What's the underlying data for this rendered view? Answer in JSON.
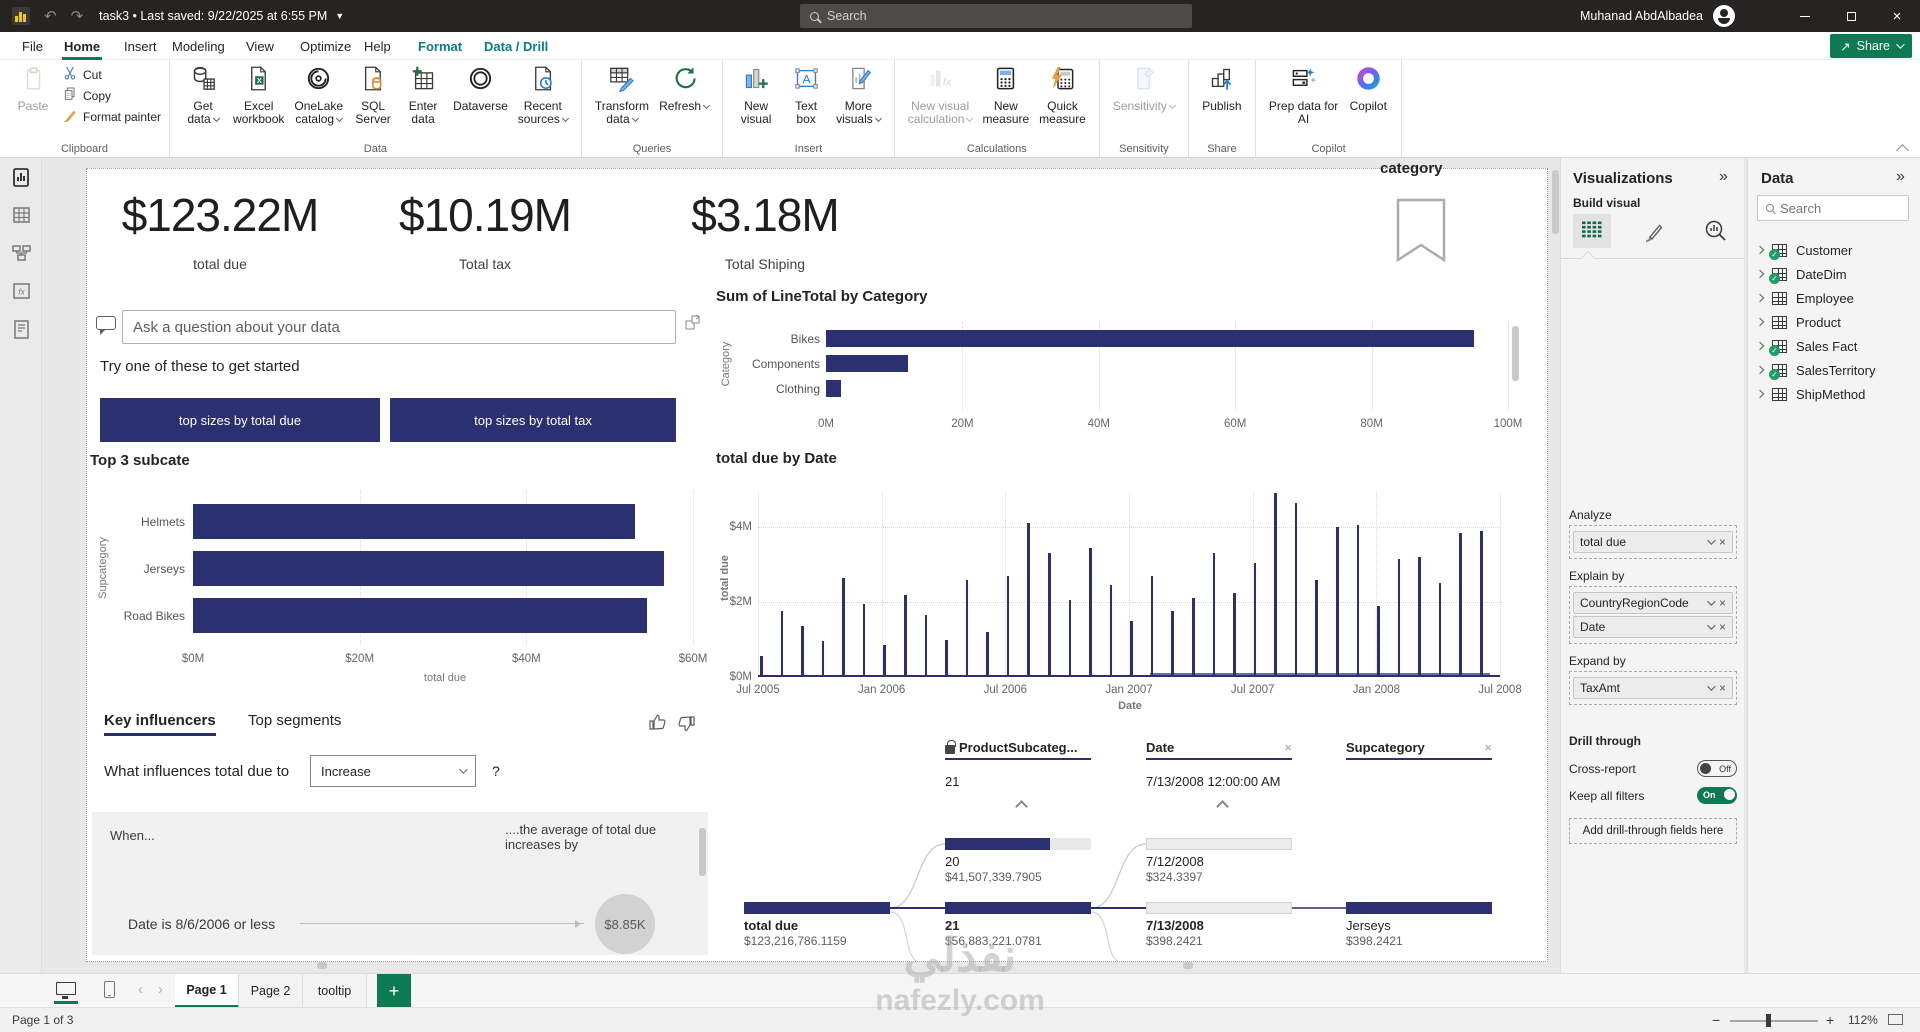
{
  "titlebar": {
    "title": "task3 • Last saved: 9/22/2025 at 6:55 PM",
    "search_placeholder": "Search",
    "user": "Muhanad AbdAlbadea"
  },
  "ribbon": {
    "tabs": [
      {
        "label": "File"
      },
      {
        "label": "Home",
        "active": true
      },
      {
        "label": "Insert"
      },
      {
        "label": "Modeling"
      },
      {
        "label": "View"
      },
      {
        "label": "Optimize"
      },
      {
        "label": "Help"
      },
      {
        "label": "Format",
        "contextual": true
      },
      {
        "label": "Data / Drill",
        "contextual": true
      }
    ],
    "share_label": "Share",
    "clipboard": {
      "paste": "Paste",
      "cut": "Cut",
      "copy": "Copy",
      "format_painter": "Format painter"
    },
    "groups": [
      {
        "label": "Clipboard",
        "type": "clipboard"
      },
      {
        "label": "Data",
        "buttons": [
          {
            "icon": "get-data",
            "lines": [
              "Get",
              "data"
            ],
            "dd": true
          },
          {
            "icon": "excel",
            "lines": [
              "Excel",
              "workbook"
            ]
          },
          {
            "icon": "onelake",
            "lines": [
              "OneLake",
              "catalog"
            ],
            "dd": true
          },
          {
            "icon": "sql",
            "lines": [
              "SQL",
              "Server"
            ]
          },
          {
            "icon": "enter-data",
            "lines": [
              "Enter",
              "data"
            ]
          },
          {
            "icon": "dataverse",
            "lines": [
              "Dataverse"
            ]
          },
          {
            "icon": "recent",
            "lines": [
              "Recent",
              "sources"
            ],
            "dd": true
          }
        ]
      },
      {
        "label": "Queries",
        "buttons": [
          {
            "icon": "transform",
            "lines": [
              "Transform",
              "data"
            ],
            "dd": true
          },
          {
            "icon": "refresh",
            "lines": [
              "Refresh"
            ],
            "dd": true
          }
        ]
      },
      {
        "label": "Insert",
        "buttons": [
          {
            "icon": "new-visual",
            "lines": [
              "New",
              "visual"
            ]
          },
          {
            "icon": "text-box",
            "lines": [
              "Text",
              "box"
            ]
          },
          {
            "icon": "more-visuals",
            "lines": [
              "More",
              "visuals"
            ],
            "dd": true
          }
        ]
      },
      {
        "label": "Calculations",
        "buttons": [
          {
            "icon": "new-calc",
            "lines": [
              "New visual",
              "calculation"
            ],
            "dd": true,
            "disabled": true
          },
          {
            "icon": "new-measure",
            "lines": [
              "New",
              "measure"
            ]
          },
          {
            "icon": "quick-measure",
            "lines": [
              "Quick",
              "measure"
            ]
          }
        ]
      },
      {
        "label": "Sensitivity",
        "buttons": [
          {
            "icon": "sensitivity",
            "lines": [
              "Sensitivity"
            ],
            "dd": true,
            "disabled": true
          }
        ]
      },
      {
        "label": "Share",
        "buttons": [
          {
            "icon": "publish",
            "lines": [
              "Publish"
            ]
          }
        ]
      },
      {
        "label": "Copilot",
        "buttons": [
          {
            "icon": "prep-data",
            "lines": [
              "Prep data for",
              "AI"
            ]
          },
          {
            "icon": "copilot",
            "lines": [
              "Copilot"
            ]
          }
        ]
      }
    ]
  },
  "leftrail": {
    "items": [
      "report-view",
      "table-view",
      "model-view",
      "dax-query-view",
      "report-builder-view"
    ],
    "active": "report-view"
  },
  "canvas": {
    "kpis": [
      {
        "value": "$123.22M",
        "label": "total due"
      },
      {
        "value": "$10.19M",
        "label": "Total tax"
      },
      {
        "value": "$3.18M",
        "label": "Total Shiping"
      }
    ],
    "bookmark_label": "category",
    "qna": {
      "placeholder": "Ask a question about your data",
      "prompt": "Try one of these to get started",
      "suggestions": [
        "top sizes by total due",
        "top sizes by total tax"
      ]
    },
    "key_influencers": {
      "tabs": [
        "Key influencers",
        "Top segments"
      ],
      "active_tab": "Key influencers",
      "question": "What influences total due to",
      "dropdown_value": "Increase",
      "help": "?",
      "when_label": "When...",
      "effect_line1": "....the average of total due",
      "effect_line2": "increases by",
      "factor": "Date is 8/6/2006 or less",
      "bubble_value": "$8.85K"
    },
    "decomposition_tree": {
      "columns": [
        {
          "header": "ProductSubcateg...",
          "locked": true,
          "selected": "21"
        },
        {
          "header": "Date",
          "removable": true,
          "selected": "7/13/2008 12:00:00 AM"
        },
        {
          "header": "Supcategory",
          "removable": true,
          "selected": ""
        }
      ],
      "root": {
        "label": "total due",
        "value": "$123,216,786.1159"
      },
      "nodes": [
        {
          "col": 1,
          "row": "top",
          "label": "20",
          "value": "$41,507,339.7905",
          "bar": "dark",
          "bar_pct": 72
        },
        {
          "col": 1,
          "row": "bottom",
          "label": "21",
          "value": "$56,883,221.0781",
          "bar": "dark",
          "bar_pct": 100,
          "bold": true
        },
        {
          "col": 2,
          "row": "top",
          "label": "7/12/2008",
          "value": "$324.3397",
          "bar": "light",
          "bar_pct": 100
        },
        {
          "col": 2,
          "row": "bottom",
          "label": "7/13/2008",
          "value": "$398.2421",
          "bar": "light",
          "bar_pct": 100,
          "bold": true
        },
        {
          "col": 3,
          "row": "bottom",
          "label": "Jerseys",
          "value": "$398.2421",
          "bar": "dark",
          "bar_pct": 100
        }
      ]
    }
  },
  "chart_data": [
    {
      "id": "top3",
      "type": "bar",
      "orientation": "horizontal",
      "title": "Top 3 subcate",
      "categories": [
        "Helmets",
        "Jerseys",
        "Road Bikes"
      ],
      "values": [
        53,
        56.5,
        54.5
      ],
      "xlabel": "total due",
      "ylabel": "Supcategory",
      "xticks": [
        "$0M",
        "$20M",
        "$40M",
        "$60M"
      ],
      "xlim": [
        0,
        60
      ],
      "grid": true,
      "bar_color": "#2b3170"
    },
    {
      "id": "linetotal",
      "type": "bar",
      "orientation": "horizontal",
      "title": "Sum of LineTotal by Category",
      "categories": [
        "Bikes",
        "Components",
        "Clothing"
      ],
      "values": [
        95,
        12,
        2.2
      ],
      "xlabel": "",
      "ylabel": "Category",
      "xticks": [
        "0M",
        "20M",
        "40M",
        "60M",
        "80M",
        "100M"
      ],
      "xlim": [
        0,
        100
      ],
      "grid": true,
      "bar_color": "#2b3170"
    },
    {
      "id": "duebydate",
      "type": "bar",
      "title": "total due by Date",
      "xlabel": "Date",
      "ylabel": "total due",
      "yticks": [
        "$0M",
        "$2M",
        "$4M"
      ],
      "ylim": [
        0,
        5
      ],
      "xticks": [
        "Jul 2005",
        "Jan 2006",
        "Jul 2006",
        "Jan 2007",
        "Jul 2007",
        "Jan 2008",
        "Jul 2008"
      ],
      "values_millions": [
        0.55,
        1.75,
        1.35,
        0.95,
        2.65,
        1.95,
        0.85,
        2.2,
        1.65,
        1.0,
        2.6,
        1.2,
        2.7,
        4.1,
        3.3,
        2.05,
        3.45,
        2.45,
        1.5,
        2.7,
        1.75,
        2.1,
        3.3,
        2.25,
        3.05,
        4.9,
        4.65,
        2.6,
        4.0,
        4.05,
        1.9,
        3.15,
        3.2,
        2.5,
        3.85,
        3.9
      ],
      "grid": true,
      "bar_color": "#2b3170"
    }
  ],
  "panels": {
    "visualizations": {
      "title": "Visualizations",
      "build_visual_label": "Build visual",
      "mode_icons": [
        "build-visual",
        "format-visual",
        "analytics"
      ],
      "gallery": [
        "stacked-bar-chart",
        "stacked-column-chart",
        "clustered-bar-chart",
        "clustered-column-chart",
        "100-stacked-bar-chart",
        "100-stacked-column-chart",
        "line-chart",
        "area-chart",
        "stacked-area-chart",
        "line-and-stacked-column-chart",
        "line-and-clustered-column-chart",
        "ribbon-chart",
        "waterfall-chart",
        "funnel-chart",
        "scatter-chart",
        "pie-chart",
        "donut-chart",
        "treemap",
        "map",
        "filled-map",
        "shape-map",
        "azure-map",
        "gauge",
        "card",
        "multi-row-card",
        "kpi",
        "slicer",
        "table",
        "matrix",
        "r-script-visual",
        "python-visual",
        "key-influencers",
        "decomposition-tree",
        "qa-visual",
        "smart-narrative",
        "metrics",
        "paginated-report",
        "quick-create-card",
        "quick-create-slicer",
        "quick-create-text",
        "quick-create-filter",
        "quick-create-app",
        "power-apps",
        "power-automate",
        "more-visuals"
      ],
      "wells": [
        {
          "label": "Analyze",
          "fields": [
            "total due"
          ]
        },
        {
          "label": "Explain by",
          "fields": [
            "CountryRegionCode",
            "Date"
          ]
        },
        {
          "label": "Expand by",
          "fields": [
            "TaxAmt"
          ]
        }
      ],
      "drill_through": {
        "title": "Drill through",
        "cross_report_label": "Cross-report",
        "cross_report_state": "Off",
        "keep_filters_label": "Keep all filters",
        "keep_filters_state": "On",
        "add_fields_label": "Add drill-through fields here"
      }
    },
    "data": {
      "title": "Data",
      "search_placeholder": "Search",
      "tables": [
        {
          "name": "Customer",
          "checked": true
        },
        {
          "name": "DateDim",
          "checked": true
        },
        {
          "name": "Employee",
          "checked": false
        },
        {
          "name": "Product",
          "checked": false
        },
        {
          "name": "Sales Fact",
          "checked": true
        },
        {
          "name": "SalesTerritory",
          "checked": true
        },
        {
          "name": "ShipMethod",
          "checked": false
        }
      ]
    }
  },
  "pagebar": {
    "pages": [
      "Page 1",
      "Page 2",
      "tooltip"
    ],
    "active_page": "Page 1"
  },
  "statusbar": {
    "page_indicator": "Page 1 of 3",
    "zoom_level": "112%"
  },
  "watermark": {
    "line1": "نفذلي",
    "line2": "nafezly.com"
  },
  "colors": {
    "navy": "#2b3170",
    "green": "#0e7a54",
    "teal": "#0b7c84",
    "titlebar": "#252423"
  }
}
